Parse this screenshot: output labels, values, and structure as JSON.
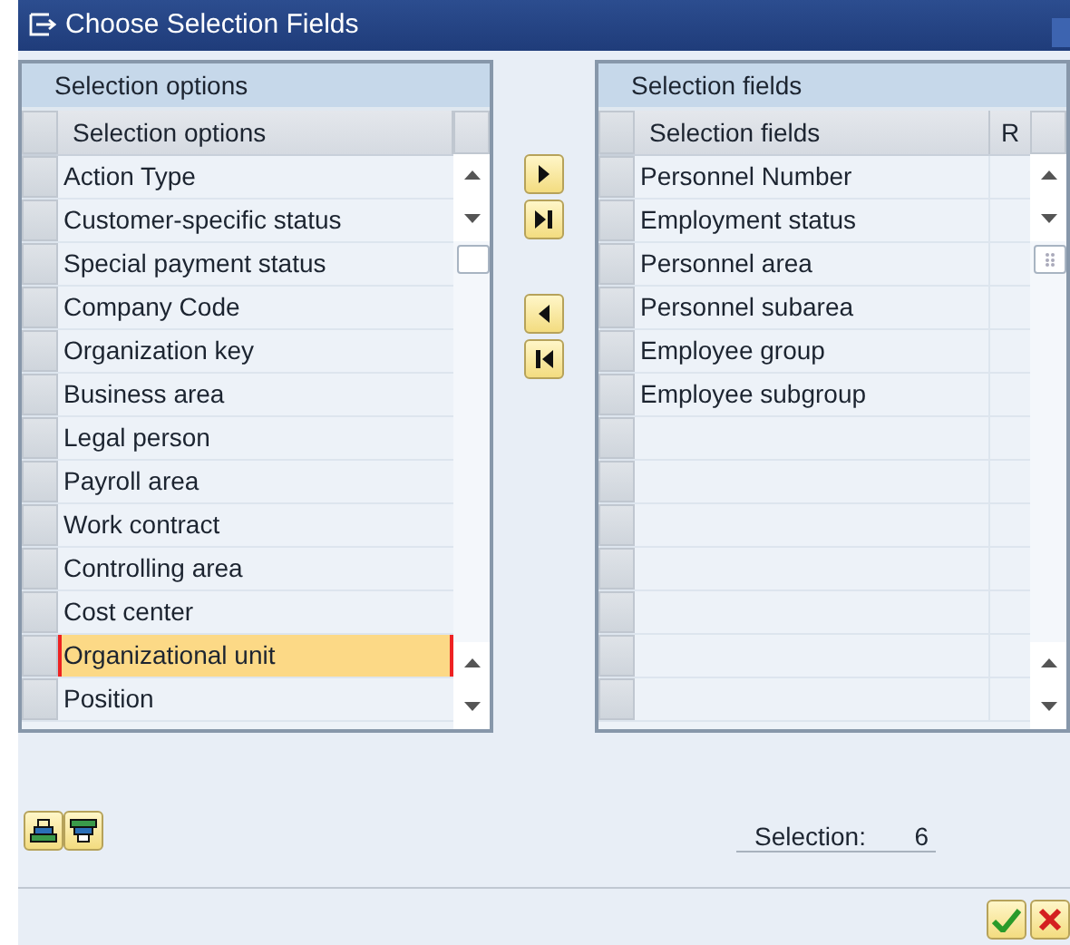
{
  "window": {
    "title": "Choose Selection Fields"
  },
  "left_panel": {
    "title": "Selection options",
    "column": "Selection options",
    "rows": [
      {
        "label": "Action Type",
        "selected": false
      },
      {
        "label": "Customer-specific status",
        "selected": false
      },
      {
        "label": "Special payment status",
        "selected": false
      },
      {
        "label": "Company Code",
        "selected": false
      },
      {
        "label": "Organization key",
        "selected": false
      },
      {
        "label": "Business area",
        "selected": false
      },
      {
        "label": "Legal person",
        "selected": false
      },
      {
        "label": "Payroll area",
        "selected": false
      },
      {
        "label": "Work contract",
        "selected": false
      },
      {
        "label": "Controlling area",
        "selected": false
      },
      {
        "label": "Cost center",
        "selected": false
      },
      {
        "label": "Organizational unit",
        "selected": true
      },
      {
        "label": "Position",
        "selected": false
      }
    ]
  },
  "right_panel": {
    "title": "Selection fields",
    "columns": [
      "Selection fields",
      "R"
    ],
    "rows": [
      {
        "label": "Personnel Number",
        "selected": false
      },
      {
        "label": "Employment status",
        "selected": false
      },
      {
        "label": "Personnel area",
        "selected": false
      },
      {
        "label": "Personnel subarea",
        "selected": false
      },
      {
        "label": "Employee group",
        "selected": false
      },
      {
        "label": "Employee subgroup",
        "selected": false
      }
    ]
  },
  "selection": {
    "label": "Selection:",
    "count": "6"
  }
}
